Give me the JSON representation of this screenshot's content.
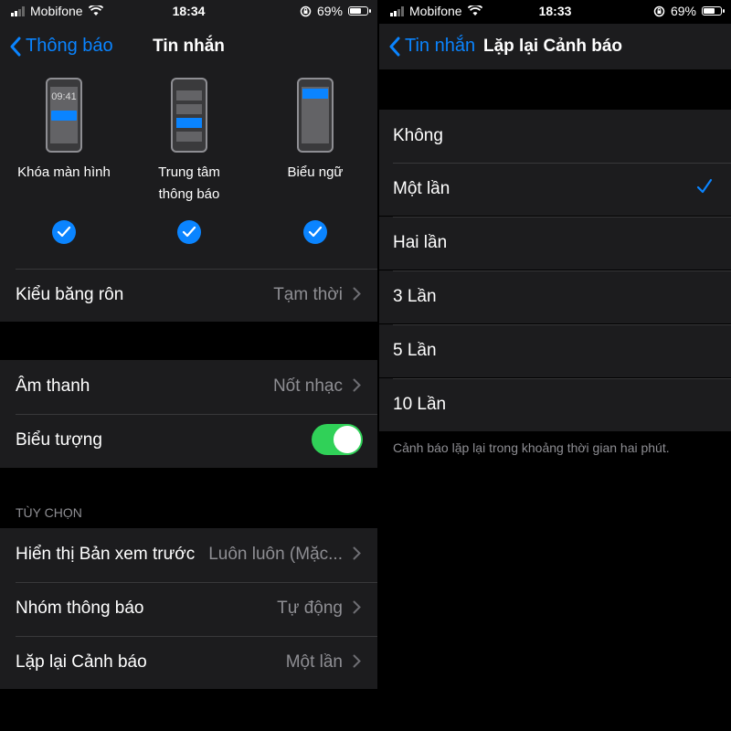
{
  "left": {
    "status": {
      "carrier": "Mobifone",
      "time": "18:34",
      "battery": "69%"
    },
    "nav": {
      "back_label": "Thông báo",
      "title": "Tin nhắn"
    },
    "alerts": [
      {
        "label": "Khóa màn hình",
        "preview_time": "09:41",
        "checked": true
      },
      {
        "label": "Trung tâm\nthông báo",
        "checked": true
      },
      {
        "label": "Biểu ngữ",
        "checked": true
      }
    ],
    "banner_style": {
      "label": "Kiểu băng rôn",
      "value": "Tạm thời"
    },
    "sounds": {
      "label": "Âm thanh",
      "value": "Nốt nhạc"
    },
    "badges": {
      "label": "Biểu tượng",
      "on": true
    },
    "options_header": "TÙY CHỌN",
    "preview": {
      "label": "Hiển thị Bản xem trước",
      "value": "Luôn luôn (Mặc..."
    },
    "grouping": {
      "label": "Nhóm thông báo",
      "value": "Tự động"
    },
    "repeat": {
      "label": "Lặp lại Cảnh báo",
      "value": "Một lần"
    }
  },
  "right": {
    "status": {
      "carrier": "Mobifone",
      "time": "18:33",
      "battery": "69%"
    },
    "nav": {
      "back_label": "Tin nhắn",
      "title": "Lặp lại Cảnh báo"
    },
    "options": [
      {
        "label": "Không",
        "selected": false
      },
      {
        "label": "Một lần",
        "selected": true
      },
      {
        "label": "Hai lần",
        "selected": false
      },
      {
        "label": "3 Lần",
        "selected": false
      },
      {
        "label": "5 Lần",
        "selected": false
      },
      {
        "label": "10 Lần",
        "selected": false
      }
    ],
    "footnote": "Cảnh báo lặp lại trong khoảng thời gian hai phút."
  },
  "colors": {
    "accent": "#0a84ff",
    "toggle_on": "#30d158",
    "cell_bg": "#1c1c1e",
    "secondary_text": "#8e8e93"
  }
}
